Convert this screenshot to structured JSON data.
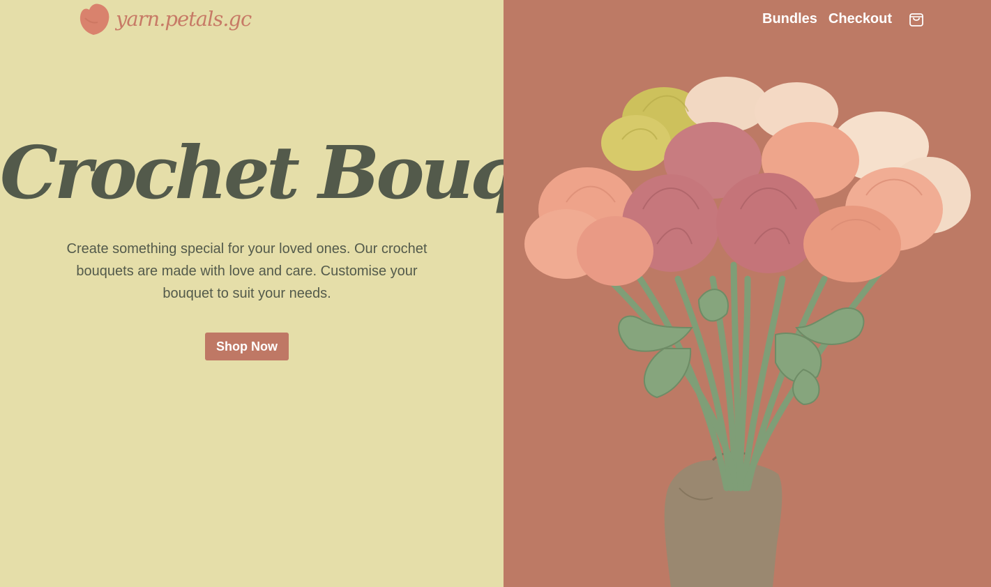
{
  "brand": {
    "logo_text": "yarn.petals.gc",
    "logo_icon": "heart-logo-icon"
  },
  "nav": {
    "links": [
      "Bundles",
      "Checkout"
    ],
    "cart_icon": "shopping-bag-icon"
  },
  "hero": {
    "title": "Crochet Bouquets",
    "subtitle": "Create something special for your loved ones. Our crochet bouquets are made with love and care. Customise your bouquet to suit your needs.",
    "cta_label": "Shop Now"
  },
  "image": {
    "subject": "crochet-tulip-bouquet"
  },
  "colors": {
    "left_bg": "#e5dea9",
    "right_bg": "#bd7a65",
    "accent": "#bf7865",
    "text_dark": "#535a4b",
    "logo": "#c77a66"
  }
}
